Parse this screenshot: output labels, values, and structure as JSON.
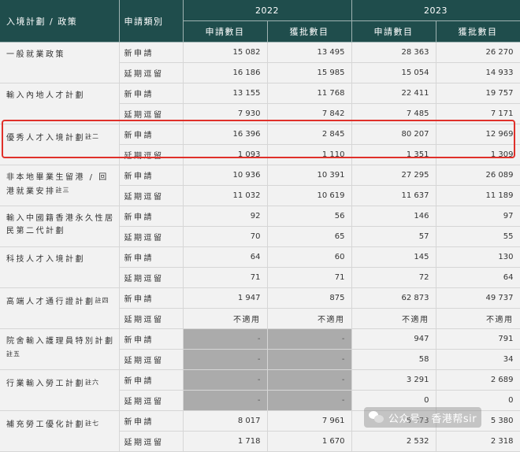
{
  "header": {
    "scheme": "入境計劃 / 政策",
    "type": "申請類別",
    "years": [
      "2022",
      "2023"
    ],
    "sub": [
      "申請數目",
      "獲批數目",
      "申請數目",
      "獲批數目"
    ]
  },
  "types": {
    "new": "新申請",
    "ext": "延期逗留"
  },
  "rows": [
    {
      "scheme": "一般就業政策",
      "note": "",
      "new": [
        "15 082",
        "13 495",
        "28 363",
        "26 270"
      ],
      "ext": [
        "16 186",
        "15 985",
        "15 054",
        "14 933"
      ]
    },
    {
      "scheme": "輸入內地人才計劃",
      "note": "",
      "new": [
        "13 155",
        "11 768",
        "22 411",
        "19 757"
      ],
      "ext": [
        "7 930",
        "7 842",
        "7 485",
        "7 171"
      ]
    },
    {
      "scheme": "優秀人才入境計劃",
      "note": "註二",
      "new": [
        "16 396",
        "2 845",
        "80 207",
        "12 969"
      ],
      "ext": [
        "1 093",
        "1 110",
        "1 351",
        "1 309"
      ]
    },
    {
      "scheme": "非本地畢業生留港 / 回港就業安排",
      "note": "註三",
      "new": [
        "10 936",
        "10 391",
        "27 295",
        "26 089"
      ],
      "ext": [
        "11 032",
        "10 619",
        "11 637",
        "11 189"
      ]
    },
    {
      "scheme": "輸入中國籍香港永久性居民第二代計劃",
      "note": "",
      "new": [
        "92",
        "56",
        "146",
        "97"
      ],
      "ext": [
        "70",
        "65",
        "57",
        "55"
      ]
    },
    {
      "scheme": "科技人才入境計劃",
      "note": "",
      "new": [
        "64",
        "60",
        "145",
        "130"
      ],
      "ext": [
        "71",
        "71",
        "72",
        "64"
      ]
    },
    {
      "scheme": "高端人才通行證計劃",
      "note": "註四",
      "new": [
        "1 947",
        "875",
        "62 873",
        "49 737"
      ],
      "ext": [
        "不適用",
        "不適用",
        "不適用",
        "不適用"
      ]
    },
    {
      "scheme": "院舍輸入護理員特別計劃",
      "note": "註五",
      "new": [
        "-",
        "-",
        "947",
        "791"
      ],
      "ext": [
        "-",
        "-",
        "58",
        "34"
      ]
    },
    {
      "scheme": "行業輸入勞工計劃",
      "note": "註六",
      "new": [
        "-",
        "-",
        "3 291",
        "2 689"
      ],
      "ext": [
        "-",
        "-",
        "0",
        "0"
      ]
    },
    {
      "scheme": "補充勞工優化計劃",
      "note": "註七",
      "new": [
        "8 017",
        "7 961",
        "5 373",
        "5 380"
      ],
      "ext": [
        "1 718",
        "1 670",
        "2 532",
        "2 318"
      ]
    }
  ],
  "watermark": {
    "text": "公众号 · 香港帮sir",
    "icon": "wechat-icon"
  }
}
